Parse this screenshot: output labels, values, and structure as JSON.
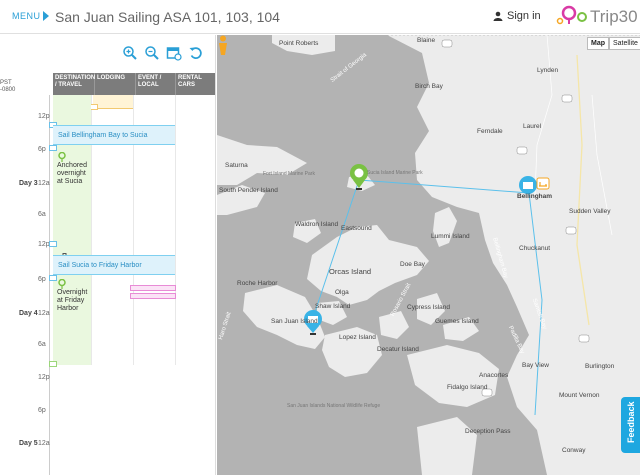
{
  "header": {
    "menu_label": "MENU",
    "trip_title": "San Juan Sailing ASA 101, 103, 104",
    "signin_label": "Sign in",
    "logo_text": "Trip30"
  },
  "sidebar": {
    "timezone": "PST\n-0800",
    "columns": [
      "DESTINATION / TRAVEL",
      "LODGING",
      "EVENT / LOCAL",
      "RENTAL CARS"
    ],
    "ticks": [
      "12p",
      "6p",
      "12a",
      "6a",
      "12p",
      "6p",
      "12a",
      "6a",
      "12p",
      "6p",
      "12a"
    ],
    "days": [
      "Day 3",
      "Day 4",
      "Day 5"
    ],
    "segments": [
      "Sail Bellingham Bay to Sucia",
      "Sail Sucia to Friday Harbor"
    ],
    "notes": [
      "Anchored overnight at Sucia",
      "Overnight at Friday Harbor"
    ]
  },
  "map": {
    "type_map": "Map",
    "type_satellite": "Satellite",
    "feedback": "Feedback",
    "places": [
      "Point Roberts",
      "Blaine",
      "Strait of Georgia",
      "Lynden",
      "Birch Bay",
      "Ferndale",
      "Laurel",
      "Saturna",
      "Fort Island Marine Park",
      "South Pender Island",
      "Sucia Island Marine Park",
      "Bellingham",
      "Sudden Valley",
      "Waldron Island",
      "Eastsound",
      "Lummi Island",
      "Chuckanut",
      "Orcas Island",
      "Doe Bay",
      "Roche Harbor",
      "Olga",
      "San Juan Island",
      "Shaw Island",
      "Lopez Island",
      "Decatur Island",
      "Cypress Island",
      "Haro Strait",
      "Rosario Strait",
      "Bellingham Bay",
      "Padilla Bay",
      "Anacortes",
      "Bay View",
      "Burlington",
      "Fidalgo Island",
      "Mount Vernon",
      "San Juan Islands National Wildlife Refuge",
      "Deception Pass",
      "Samish Bay",
      "Guemes Island",
      "Conway"
    ],
    "route_color": "#5bc0eb",
    "pin_color": "#7ac143"
  }
}
